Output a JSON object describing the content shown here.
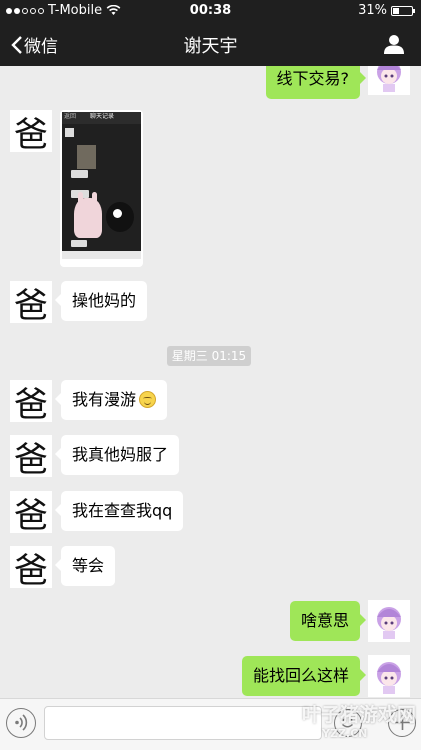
{
  "status_bar": {
    "carrier": "T-Mobile",
    "time": "00:38",
    "battery_percent": "31%",
    "battery_level": 0.31
  },
  "nav": {
    "back_label": "微信",
    "title": "谢天宇"
  },
  "contact_avatar_glyph": "爸",
  "messages": [
    {
      "side": "out",
      "text": "线下交易?"
    },
    {
      "side": "in",
      "type": "image"
    },
    {
      "side": "in",
      "text": "操他妈的"
    },
    {
      "side": "in",
      "text": "我有漫游"
    },
    {
      "side": "in",
      "text": "我真他妈服了"
    },
    {
      "side": "in",
      "text": "我在查查我qq"
    },
    {
      "side": "in",
      "text": "等会"
    },
    {
      "side": "out",
      "text": "啥意思"
    },
    {
      "side": "out",
      "text": "能找回么这样"
    }
  ],
  "timestamp": "星期三 01:15",
  "image_preview": {
    "back": "返回",
    "title": "聊天记录"
  },
  "input": {
    "value": "",
    "placeholder": ""
  },
  "watermark": {
    "text": "叶子猪游戏网",
    "sub": "YZZ.CN"
  },
  "colors": {
    "bar": "#1f1f1f",
    "background": "#ececec",
    "outgoing_bubble": "#9fe658",
    "incoming_bubble": "#ffffff"
  }
}
